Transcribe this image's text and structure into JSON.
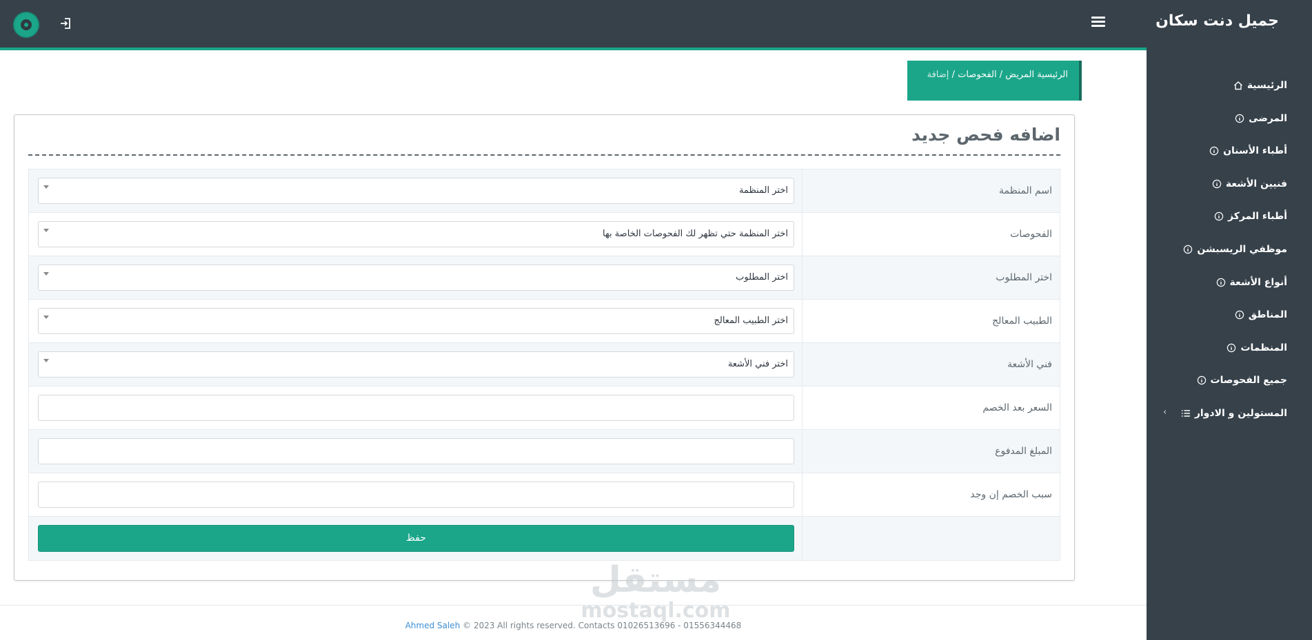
{
  "app": {
    "brand": "جميل دنت سكان"
  },
  "icons": {
    "menu": "hamburger-icon",
    "logout": "logout-icon",
    "home": "home-icon",
    "info": "info-icon",
    "list": "list-icon",
    "chevron": "chevron-left-icon"
  },
  "colors": {
    "accent": "#1ba68a",
    "sidebar": "#36414a",
    "link": "#3d8fd6"
  },
  "sidebar": {
    "items": [
      {
        "label": "الرئيسية"
      },
      {
        "label": "المرضى"
      },
      {
        "label": "أطباء الأسنان"
      },
      {
        "label": "فنيين الأشعة"
      },
      {
        "label": "أطباء المركز"
      },
      {
        "label": "موظفي الريسبشن"
      },
      {
        "label": "أنواع الأشعة"
      },
      {
        "label": "المناطق"
      },
      {
        "label": "المنظمات"
      },
      {
        "label": "جميع الفحوصات"
      },
      {
        "label": "المستولين و الادوار",
        "arrow": "‹"
      }
    ]
  },
  "breadcrumb": {
    "home": "الرئيسية",
    "patient": "المريض",
    "sep": "/",
    "exams": "الفحوصات",
    "current": "إضافة"
  },
  "form": {
    "title": "اضافه فحص جديد",
    "rows": [
      {
        "label": "اسم المنظمة",
        "value": "اختر المنظمة"
      },
      {
        "label": "الفحوصات",
        "value": "اختر المنظمة حتي تظهر لك الفحوصات الخاصة بها"
      },
      {
        "label": "اختر المطلوب",
        "value": "اختر المطلوب"
      },
      {
        "label": "الطبيب المعالج",
        "value": "اختر الطبيب المعالج"
      },
      {
        "label": "فني الأشعة",
        "value": "اختر فني الأشعة"
      },
      {
        "label": "السعر بعد الخصم",
        "value": ""
      },
      {
        "label": "المبلغ المدفوع",
        "value": ""
      },
      {
        "label": "سبب الخصم إن وجد",
        "value": ""
      }
    ],
    "save_label": "حفظ"
  },
  "watermark": {
    "arabic": "مستقل",
    "latin": "mostaql.com"
  },
  "footer": {
    "author": "Ahmed Saleh",
    "text": "© 2023 All rights reserved. Contacts 01026513696 - 01556344468"
  }
}
